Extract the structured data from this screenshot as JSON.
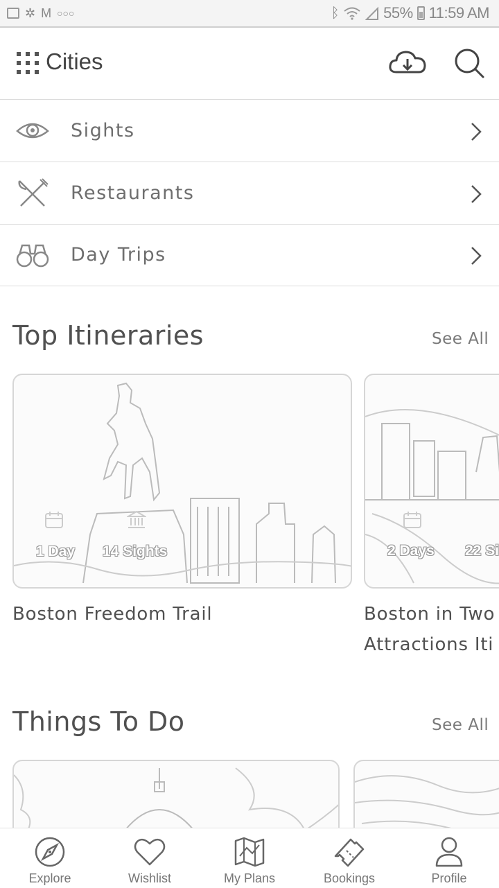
{
  "status_bar": {
    "battery": "55%",
    "time": "11:59 AM",
    "notification_icons": [
      "gallery-icon",
      "pinwheel-icon",
      "gmail-icon",
      "more-icon"
    ],
    "system_icons": [
      "bluetooth-icon",
      "wifi-icon",
      "signal-icon",
      "battery-icon"
    ]
  },
  "header": {
    "title": "Cities",
    "icons": [
      "grid-menu-icon",
      "cloud-download-icon",
      "search-icon"
    ]
  },
  "menu": [
    {
      "label": "Sights",
      "icon": "eye-icon"
    },
    {
      "label": "Restaurants",
      "icon": "fork-knife-icon"
    },
    {
      "label": "Day Trips",
      "icon": "binoculars-icon"
    }
  ],
  "top_itineraries": {
    "title": "Top Itineraries",
    "see_all": "See All",
    "cards": [
      {
        "title": "Boston Freedom Trail",
        "title_line2": "",
        "days": "1 Day",
        "sights": "14 Sights"
      },
      {
        "title": "Boston in Two",
        "title_line2": "Attractions Iti",
        "days": "2 Days",
        "sights": "22 Si"
      }
    ]
  },
  "things_to_do": {
    "title": "Things To Do",
    "see_all": "See All"
  },
  "bottom_nav": [
    {
      "label": "Explore",
      "icon": "compass-icon"
    },
    {
      "label": "Wishlist",
      "icon": "heart-icon"
    },
    {
      "label": "My Plans",
      "icon": "map-icon"
    },
    {
      "label": "Bookings",
      "icon": "ticket-icon"
    },
    {
      "label": "Profile",
      "icon": "person-icon"
    }
  ]
}
